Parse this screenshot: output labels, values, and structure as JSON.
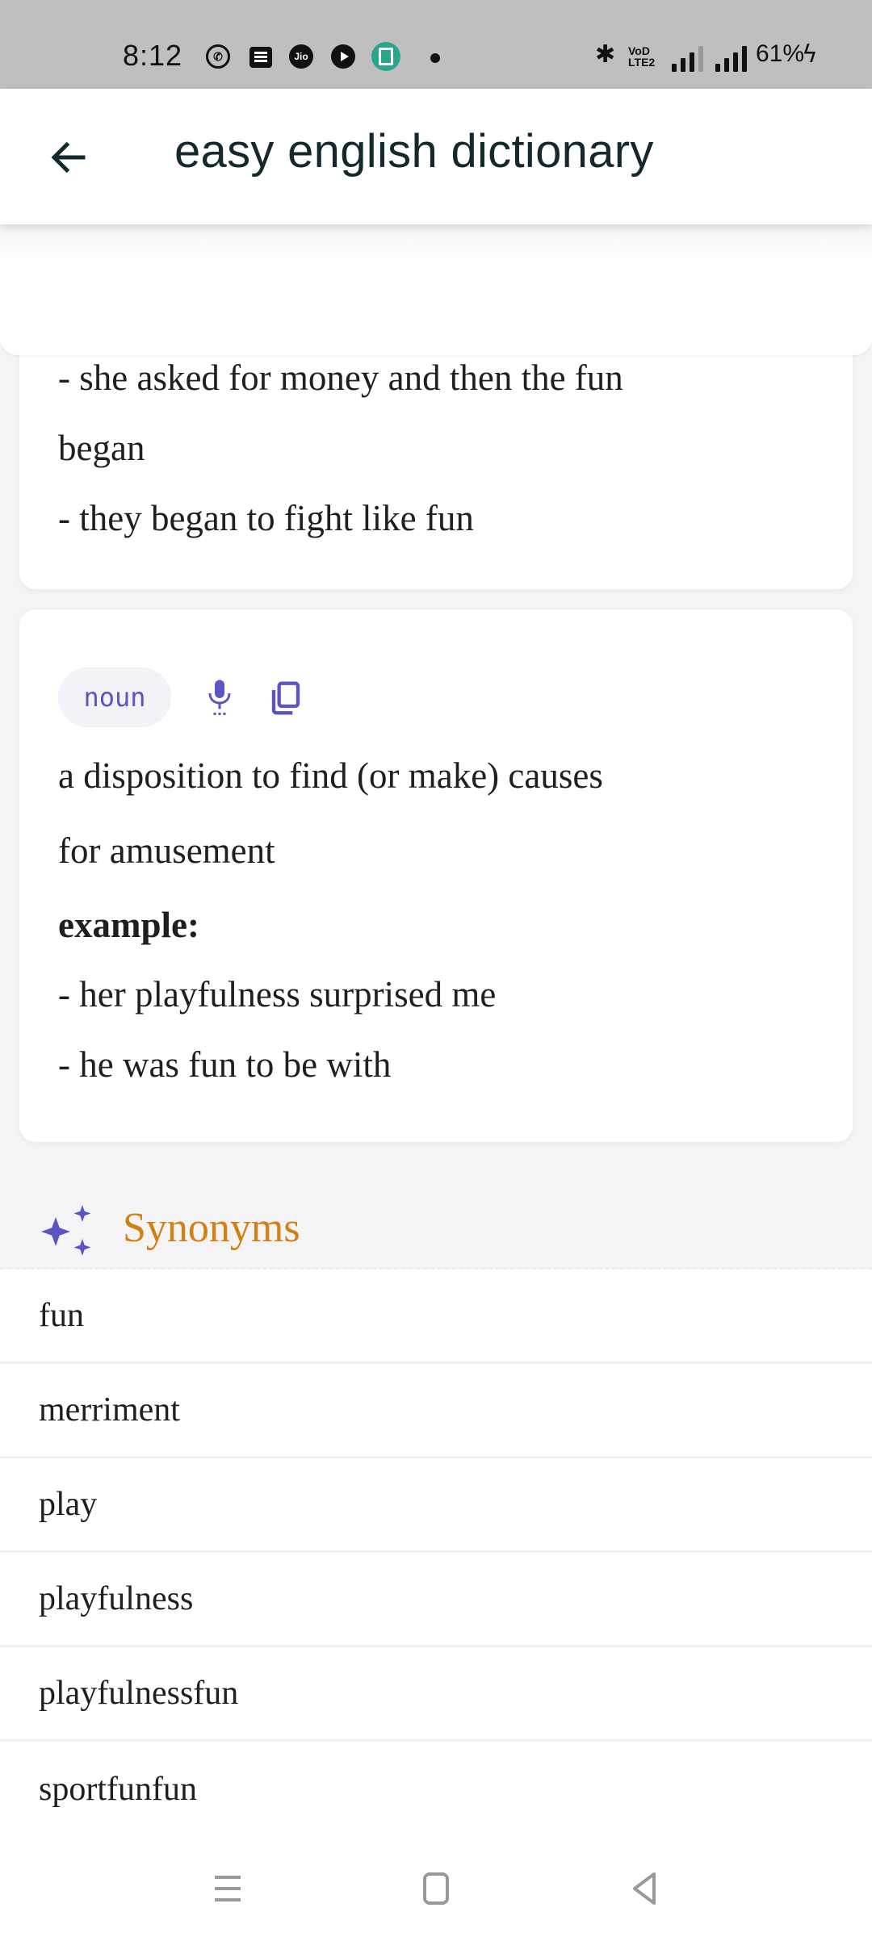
{
  "status_bar": {
    "time": "8:12",
    "notification_icons": [
      "whatsapp-icon",
      "message-icon",
      "jio-icon",
      "play-icon",
      "store-icon",
      "more-dot-icon"
    ],
    "jio_label": "Jio",
    "bluetooth": "bluetooth-icon",
    "volte_line1": "VoD",
    "volte_line2": "LTE2",
    "battery": "61%",
    "charging": true
  },
  "header": {
    "back_icon": "arrow-left-icon",
    "title": "easy english dictionary"
  },
  "colors": {
    "status_bar_bg": "#bfbfbf",
    "title": "#14292e",
    "accent_purple": "#5b55c4",
    "synonyms_orange": "#d47f10",
    "chip_bg": "#f3f2f8"
  },
  "definition_cards": [
    {
      "partial": true,
      "examples": [
        "- she asked for money and then the fun",
        "began",
        "- they began to fight like fun"
      ]
    },
    {
      "part_of_speech": "noun",
      "icons": [
        "microphone-icon",
        "copy-icon"
      ],
      "definition_lines": [
        "a disposition to find (or make) causes",
        "for amusement"
      ],
      "example_label": "example:",
      "examples": [
        "- her playfulness surprised me",
        "- he was fun to be with"
      ]
    }
  ],
  "synonyms": {
    "icon": "sparkle-icon",
    "title": "Synonyms",
    "items": [
      "fun",
      "merriment",
      "play",
      "playfulness",
      "playfulnessfun",
      "sportfunfun"
    ]
  },
  "nav_bar": {
    "buttons": [
      "recents-menu-icon",
      "home-icon",
      "back-triangle-icon"
    ]
  }
}
